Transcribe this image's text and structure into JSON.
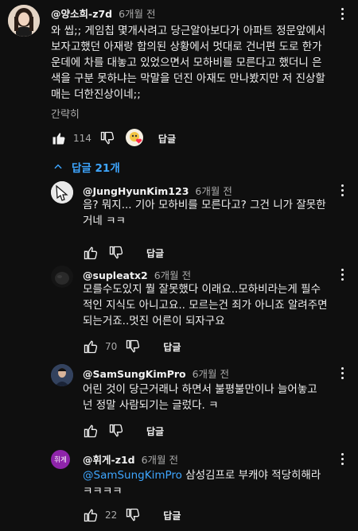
{
  "main_comment": {
    "author": "@양소희-z7d",
    "time": "6개월 전",
    "text": "와 씹;; 게임칩 몇개사려고 당근알아보다가 아파트 정문앞에서 보자고했던 아재랑 합의된 상황에서 멋대로 건너편 도로 한가운데에 차를 대놓고 있었으면서 모하비를 모른다고 했더니 은색을 구분 못하냐는 막말을 던진 아재도 만나봤지만 저 진상할매는 더한진상이네;;",
    "read_more": "간략히",
    "likes": "114",
    "reply_label": "답글"
  },
  "replies_toggle": {
    "label": "답글 21개"
  },
  "replies": [
    {
      "author": "@JungHyunKim123",
      "time": "6개월 전",
      "text": "음? 뭐지... 기아 모하비를 모른다고? 그건 니가 잘못한거네 ㅋㅋ",
      "likes": "",
      "reply_label": "답글"
    },
    {
      "author": "@supleatx2",
      "time": "6개월 전",
      "text": "모를수도있지 뭘 잘못했다 이래요..모하비라는게 필수적인 지식도 아니고요.. 모르는건 죄가 아니죠 알려주면 되는거죠..멋진 어른이 되자구요",
      "likes": "70",
      "reply_label": "답글"
    },
    {
      "author": "@SamSungKimPro",
      "time": "6개월 전",
      "text": "어린 것이 당근거래나 하면서 불평불만이나 늘어놓고 넌 정말 사람되기는 글렀다. ㅋ",
      "likes": "",
      "reply_label": "답글"
    },
    {
      "author": "@휘게-z1d",
      "time": "6개월 전",
      "avatar_text": "휘게",
      "mention": "@SamSungKimPro",
      "text": " 삼성김프로 부캐야 적당히해라 ㅋㅋㅋㅋ",
      "likes": "22",
      "reply_label": "답글"
    }
  ],
  "colors": {
    "background": "#0f0f0f",
    "text": "#f1f1f1",
    "secondary": "#aaaaaa",
    "link": "#3ea6ff",
    "purple_avatar": "#8e24aa"
  },
  "icons": {
    "like": "thumb-up-icon",
    "dislike": "thumb-down-icon",
    "heart": "creator-heart-icon",
    "more": "more-vert-icon",
    "chevron": "chevron-up-icon"
  }
}
